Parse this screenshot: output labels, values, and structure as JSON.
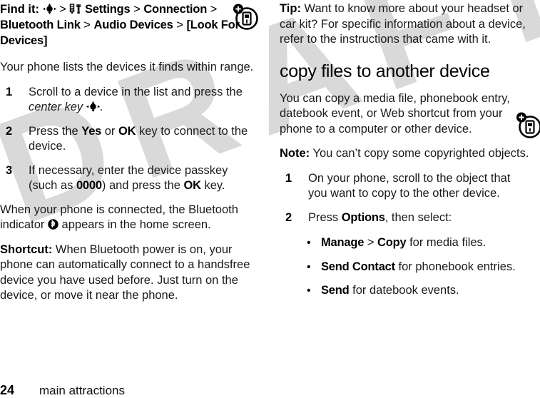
{
  "watermark": {
    "text": "DRAFT"
  },
  "left_column": {
    "find_it": {
      "label": "Find it:",
      "separator": ">",
      "path": [
        "Settings",
        "Connection",
        "Bluetooth Link",
        "Audio Devices",
        "[Look For Devices]"
      ]
    },
    "intro_paragraph": "Your phone lists the devices it finds within range.",
    "steps": [
      {
        "number": "1",
        "text_before": "Scroll to a device in the list and press the ",
        "italic_term": "center key",
        "text_after": "."
      },
      {
        "number": "2",
        "text_before": "Press the ",
        "ui_term_1": "Yes",
        "text_middle": " or ",
        "ui_term_2": "OK",
        "text_after": " key to connect to the device."
      },
      {
        "number": "3",
        "text_before": "If necessary, enter the device passkey (such as ",
        "ui_term_1": "0000",
        "text_middle": ") and press the ",
        "ui_term_2": "OK",
        "text_after": " key."
      }
    ],
    "connected_paragraph_before": "When your phone is connected, the Bluetooth indicator ",
    "connected_paragraph_after": " appears in the home screen.",
    "shortcut": {
      "label": "Shortcut:",
      "text": " When Bluetooth power is on, your phone can automatically connect to a handsfree device you have used before. Just turn on the device, or move it near the phone."
    }
  },
  "right_column": {
    "tip": {
      "label": "Tip:",
      "text": " Want to know more about your headset or car kit? For specific information about a device, refer to the instructions that came with it."
    },
    "heading": "copy files to another device",
    "body_paragraph": "You can copy a media file, phonebook entry, datebook event, or Web shortcut from your phone to a computer or other device.",
    "note": {
      "label": "Note:",
      "text": " You can’t copy some copyrighted objects."
    },
    "steps": [
      {
        "number": "1",
        "text": "On your phone, scroll to the object that you want to copy to the other device."
      },
      {
        "number": "2",
        "text_before": "Press ",
        "ui_term": "Options",
        "text_after": ", then select:"
      }
    ],
    "bullets": [
      {
        "ui_term_1": "Manage",
        "separator": " > ",
        "ui_term_2": "Copy",
        "text_after": " for media files."
      },
      {
        "ui_term_1": "Send Contact",
        "text_after": " for phonebook entries."
      },
      {
        "ui_term_1": "Send",
        "text_after": " for datebook events."
      }
    ]
  },
  "icons": {
    "center_key": "center-key-icon",
    "settings": "settings-tools-icon",
    "bluetooth_indicator": "bluetooth-indicator-icon",
    "margin_device": "phone-transfer-icon"
  },
  "footer": {
    "page_number": "24",
    "title": "main attractions"
  }
}
